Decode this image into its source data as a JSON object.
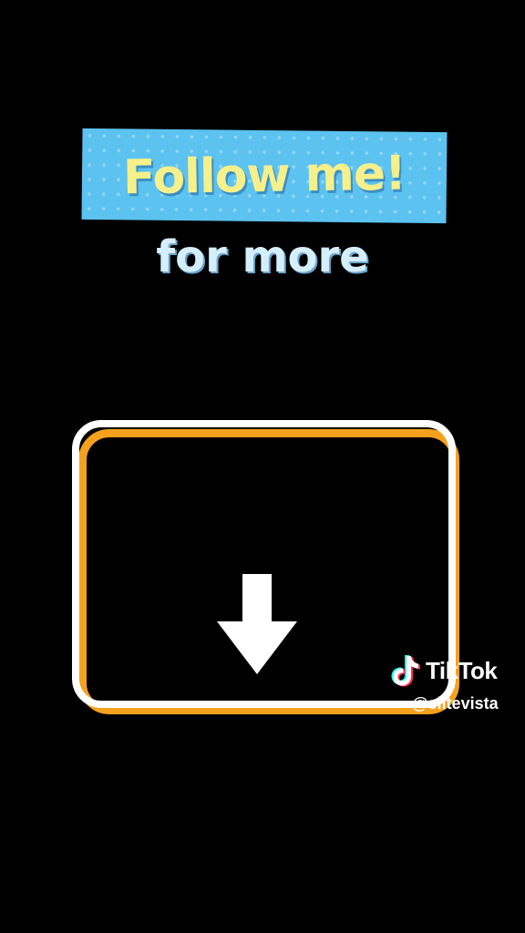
{
  "banner": {
    "title": "Follow me!",
    "background_color": "#5cc2f0",
    "text_color": "#f6f08a"
  },
  "subtitle": "for more",
  "frame": {
    "outer_color": "#f4a21d",
    "inner_color": "#ffffff",
    "icon": "down-arrow-icon"
  },
  "watermark": {
    "logo_icon": "tiktok-logo-icon",
    "brand": "TikTok",
    "handle": "@elitevista"
  }
}
